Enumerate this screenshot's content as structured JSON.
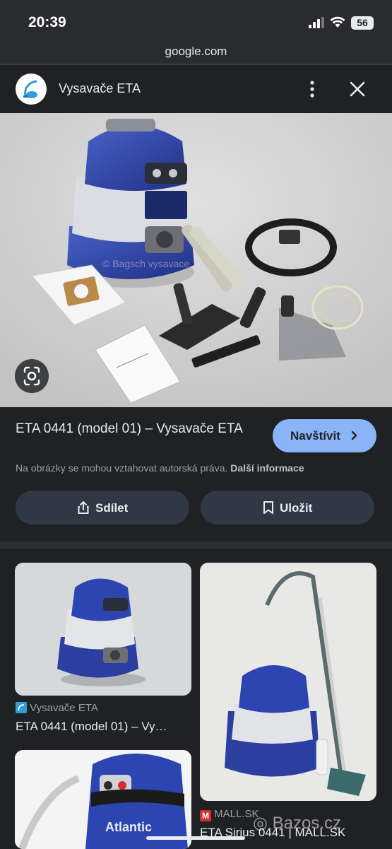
{
  "status_bar": {
    "time": "20:39",
    "battery": "56"
  },
  "browser": {
    "url": "google.com"
  },
  "header": {
    "title": "Vysavače ETA",
    "favicon_icon": "vacuum-logo-icon",
    "more_icon": "more-vert-icon",
    "close_icon": "close-icon"
  },
  "hero": {
    "lens_icon": "google-lens-icon",
    "watermark": "© Bagsch vysavace"
  },
  "result": {
    "title": "ETA 0441 (model 01) – Vysavače ETA",
    "visit_label": "Navštívit",
    "copyright": "Na obrázky se mohou vztahovat autorská práva.",
    "more_info": "Další informace"
  },
  "actions": {
    "share_label": "Sdílet",
    "save_label": "Uložit"
  },
  "related": [
    {
      "source": "Vysavače ETA",
      "title": "ETA 0441 (model 01) – Vy…"
    },
    {
      "source": "MALL.SK",
      "title": "ETA Sirius 0441 | MALL.SK"
    },
    {
      "image_text": "Atlantic"
    }
  ],
  "overlay_watermark": "Bazos.cz",
  "colors": {
    "background": "#202124",
    "accent": "#8ab4f8",
    "button": "#303846",
    "vacuum_blue": "#2a3fa0"
  }
}
